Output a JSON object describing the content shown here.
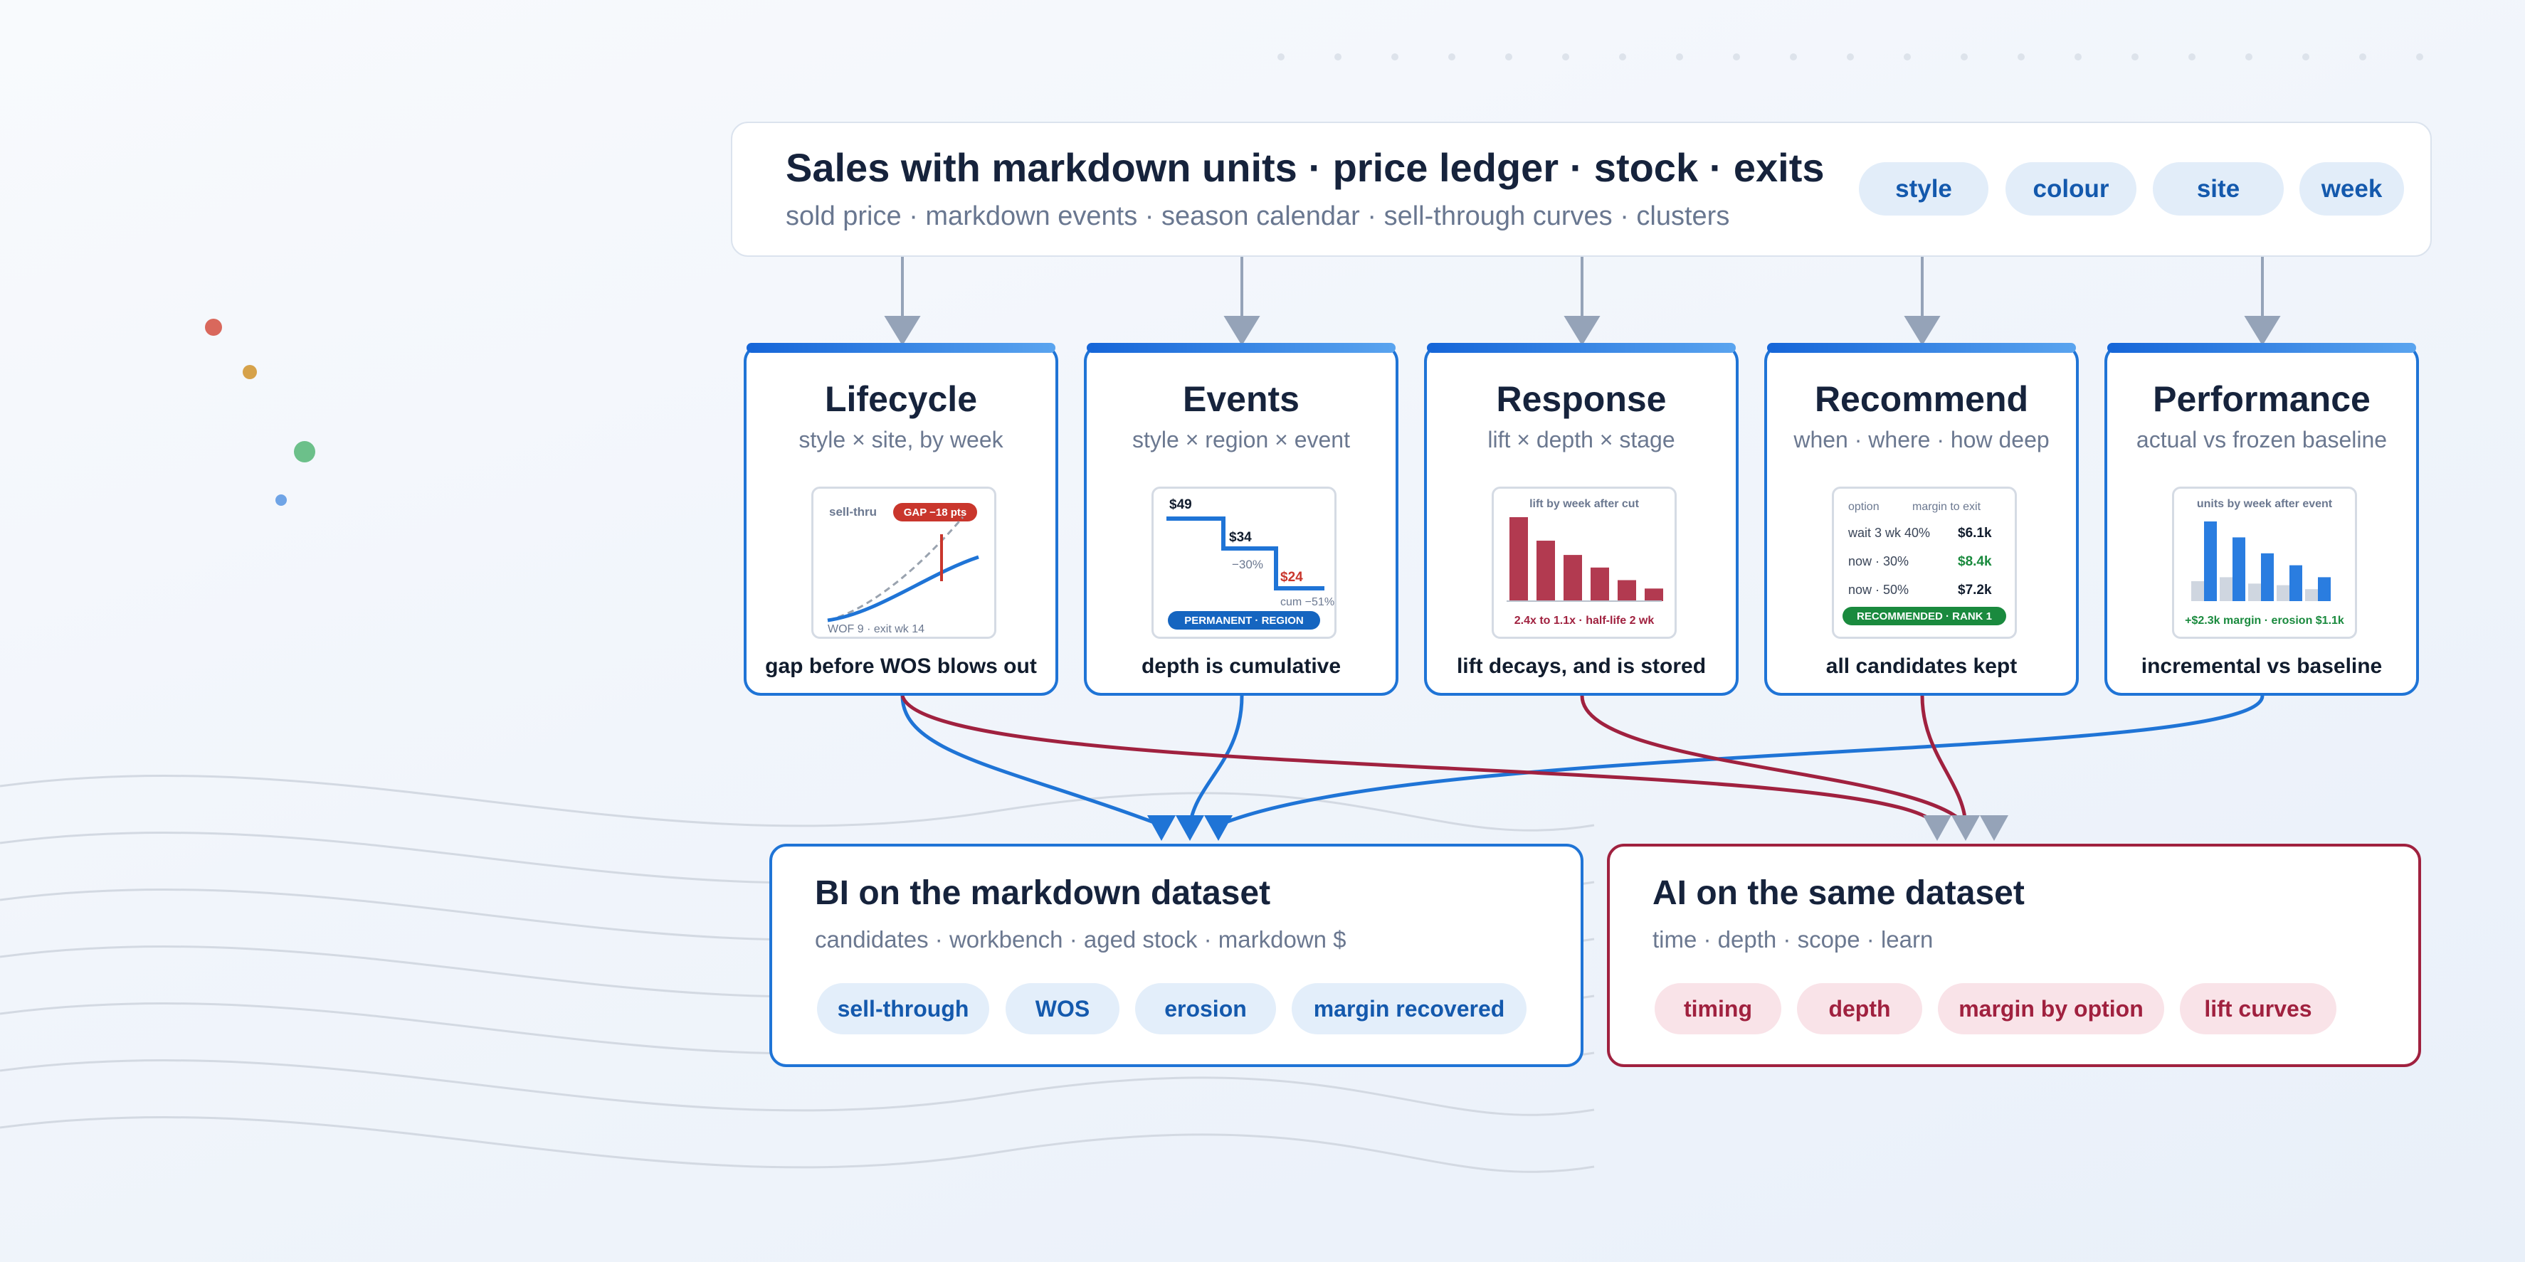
{
  "header": {
    "title": "Sales with markdown units · price ledger · stock · exits",
    "subtitle": "sold price · markdown events · season calendar · sell-through curves · clusters",
    "grains": [
      "style",
      "colour",
      "site",
      "week"
    ]
  },
  "cards": [
    {
      "title": "Lifecycle",
      "subtitle": "style × site, by week",
      "caption": "gap before WOS blows out",
      "thumb": {
        "label": "sell-thru",
        "badge": "GAP −18 pts",
        "footer": "WOF 9 · exit wk 14"
      }
    },
    {
      "title": "Events",
      "subtitle": "style × region × event",
      "caption": "depth is cumulative",
      "thumb": {
        "price_1": "$49",
        "price_2": "$34",
        "step_pct": "−30%",
        "price_3": "$24",
        "cum": "cum −51%",
        "badge": "PERMANENT · REGION"
      }
    },
    {
      "title": "Response",
      "subtitle": "lift × depth × stage",
      "caption": "lift decays, and is stored",
      "thumb": {
        "label": "lift by week after cut",
        "footer": "2.4x to 1.1x · half-life 2 wk",
        "lift_values": [
          1.0,
          0.72,
          0.55,
          0.4,
          0.25,
          0.15
        ]
      }
    },
    {
      "title": "Recommend",
      "subtitle": "when · where · how deep",
      "caption": "all candidates kept",
      "thumb": {
        "col_option": "option",
        "col_margin": "margin to exit",
        "rows": [
          {
            "option": "wait 3 wk 40%",
            "margin": "$6.1k"
          },
          {
            "option": "now · 30%",
            "margin": "$8.4k"
          },
          {
            "option": "now · 50%",
            "margin": "$7.2k"
          }
        ],
        "badge": "RECOMMENDED · RANK 1"
      }
    },
    {
      "title": "Performance",
      "subtitle": "actual vs frozen baseline",
      "caption": "incremental vs baseline",
      "thumb": {
        "label": "units by week after event",
        "footer": "+$2.3k margin · erosion $1.1k",
        "actual": [
          1.0,
          0.8,
          0.6,
          0.45,
          0.3
        ],
        "baseline": [
          0.25,
          0.3,
          0.22,
          0.2,
          0.15
        ]
      }
    }
  ],
  "bi": {
    "title": "BI on the markdown dataset",
    "subtitle": "candidates · workbench · aged stock · markdown $",
    "tags": [
      "sell-through",
      "WOS",
      "erosion",
      "margin recovered"
    ]
  },
  "ai": {
    "title": "AI on the same dataset",
    "subtitle": "time · depth · scope · learn",
    "tags": [
      "timing",
      "depth",
      "margin by option",
      "lift curves"
    ]
  },
  "colors": {
    "bi_blue": "#1f74d6",
    "ai_red": "#a0213f",
    "arrow_gray": "#95a3b8",
    "accent_red": "#c9362c",
    "accent_green": "#1a8a3e"
  }
}
